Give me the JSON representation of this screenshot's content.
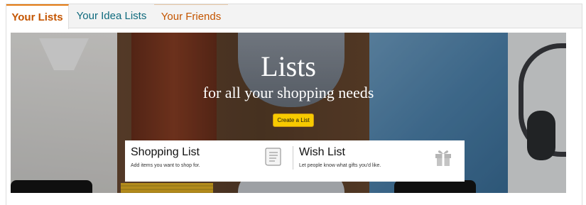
{
  "tabs": [
    {
      "label": "Your Lists",
      "active": true
    },
    {
      "label": "Your Idea Lists",
      "active": false
    },
    {
      "label": "Your Friends",
      "active": false
    }
  ],
  "hero": {
    "title": "Lists",
    "subtitle": "for all your shopping needs",
    "create_button_label": "Create a List"
  },
  "cards": [
    {
      "title": "Shopping List",
      "description": "Add items you want to shop for.",
      "icon": "receipt-icon"
    },
    {
      "title": "Wish List",
      "description": "Let people know what gifts you'd like.",
      "icon": "gift-icon"
    }
  ],
  "colors": {
    "active_tab": "#c45500",
    "idea_tab": "#0f6a7d",
    "button": "#f7ca00"
  }
}
